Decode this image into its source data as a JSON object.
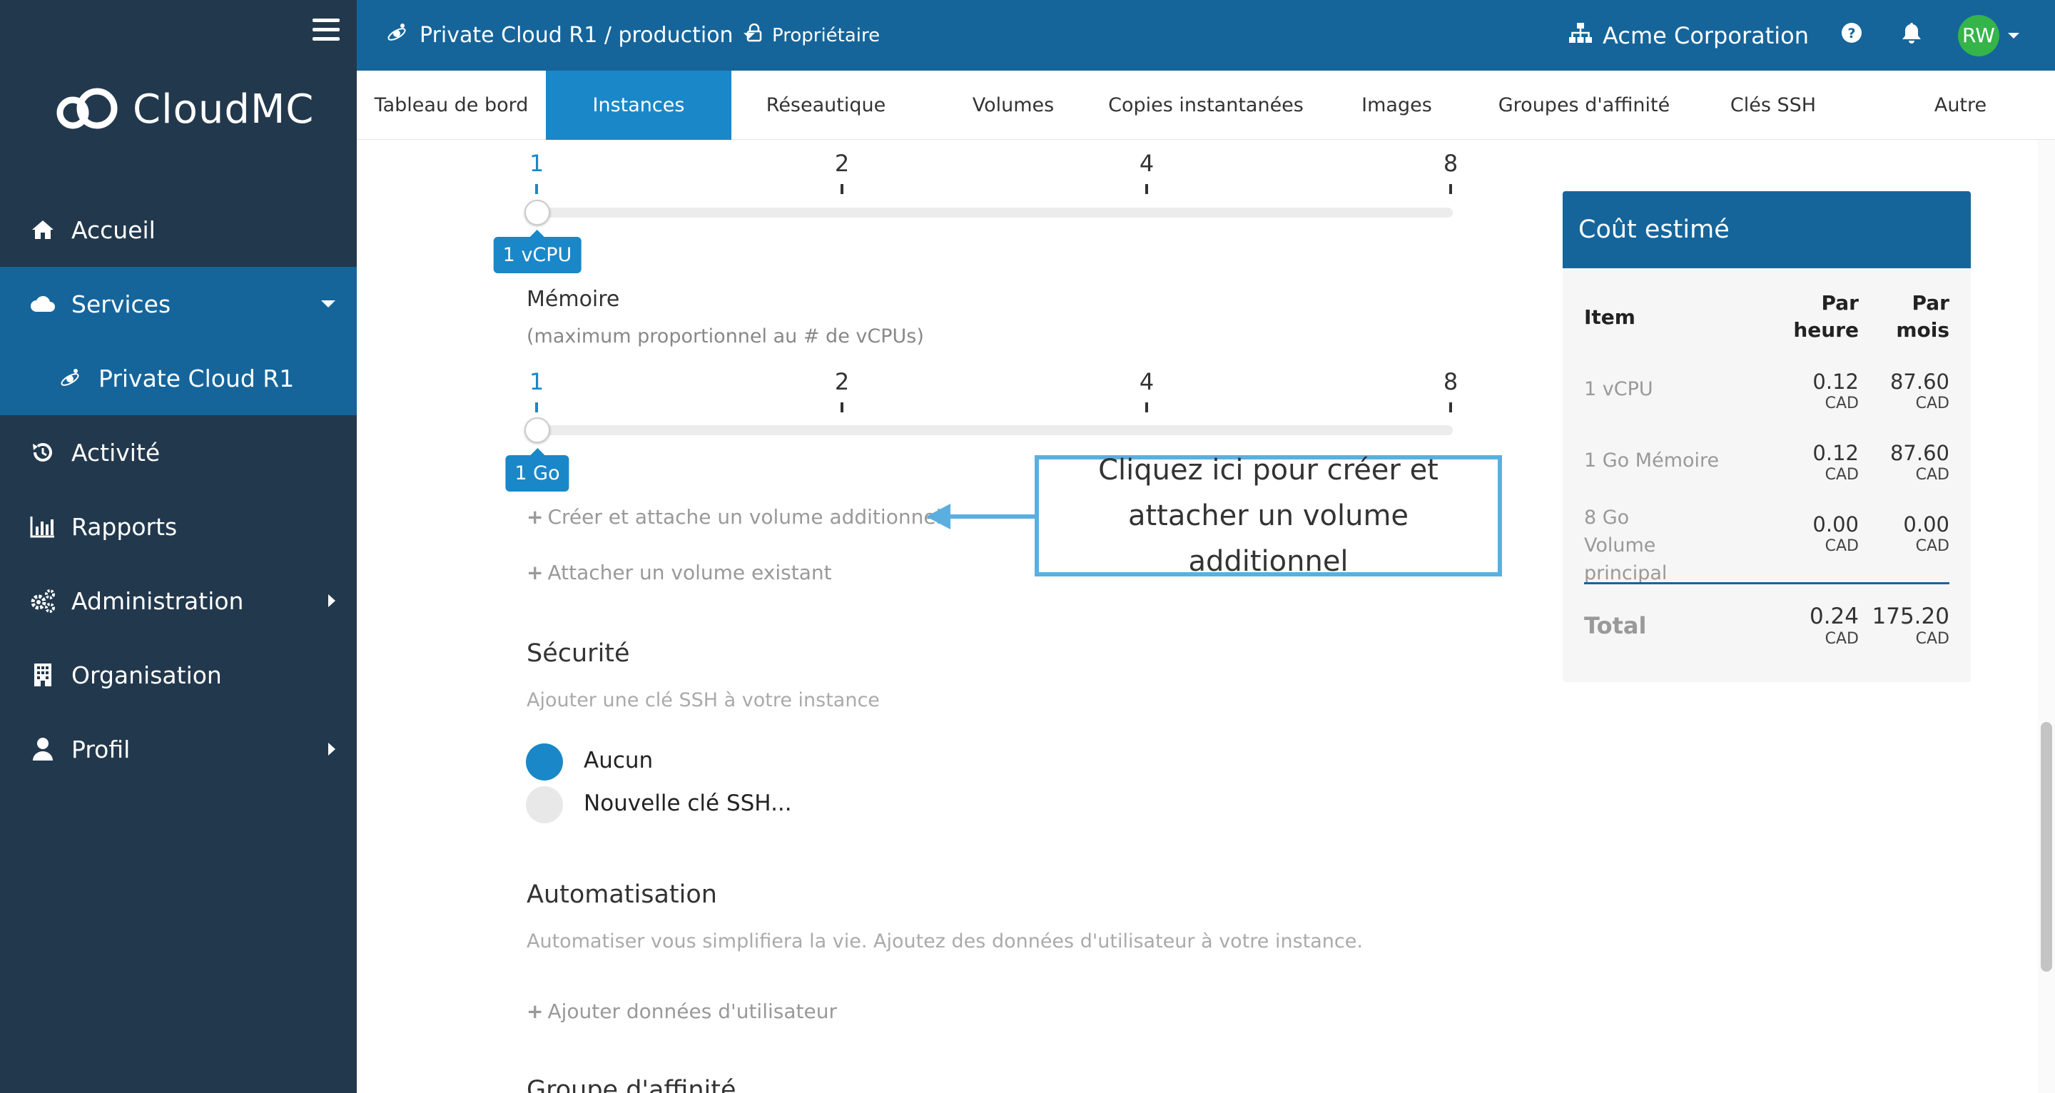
{
  "sidebar": {
    "logo_text": "CloudMC",
    "items": [
      {
        "label": "Accueil",
        "icon": "home-icon"
      },
      {
        "label": "Services",
        "icon": "cloud-icon"
      },
      {
        "label": "Private Cloud R1",
        "icon": "satellite-icon"
      },
      {
        "label": "Activité",
        "icon": "history-icon"
      },
      {
        "label": "Rapports",
        "icon": "bar-chart-icon"
      },
      {
        "label": "Administration",
        "icon": "gears-icon"
      },
      {
        "label": "Organisation",
        "icon": "building-icon"
      },
      {
        "label": "Profil",
        "icon": "user-icon"
      }
    ]
  },
  "topbar": {
    "environment": "Private Cloud R1 / production",
    "role": "Propriétaire",
    "organization": "Acme Corporation",
    "avatar_initials": "RW"
  },
  "tabs": [
    "Tableau de bord",
    "Instances",
    "Réseautique",
    "Volumes",
    "Copies instantanées",
    "Images",
    "Groupes d'affinité",
    "Clés SSH",
    "Autre"
  ],
  "active_tab": "Instances",
  "form": {
    "cpu_slider": {
      "ticks": [
        "1",
        "2",
        "4",
        "8"
      ],
      "selected": "1",
      "badge": "1 vCPU"
    },
    "memory": {
      "label": "Mémoire",
      "hint": "(maximum proportionnel au # de vCPUs)",
      "ticks": [
        "1",
        "2",
        "4",
        "8"
      ],
      "selected": "1",
      "badge": "1 Go"
    },
    "create_volume_link": "Créer et attache un volume additionnel",
    "attach_volume_link": "Attacher un volume existant",
    "callout": "Cliquez ici pour créer et attacher un volume additionnel",
    "security": {
      "title": "Sécurité",
      "hint": "Ajouter une clé SSH à votre instance",
      "options": [
        "Aucun",
        "Nouvelle clé SSH..."
      ],
      "selected": "Aucun"
    },
    "automation": {
      "title": "Automatisation",
      "hint": "Automatiser vous simplifiera la vie. Ajoutez des données d'utilisateur à votre instance.",
      "link": "Ajouter données d'utilisateur"
    },
    "affinity_title": "Groupe d'affinité"
  },
  "cost": {
    "title": "Coût estimé",
    "headers": {
      "item": "Item",
      "hour": "Par heure",
      "month": "Par mois"
    },
    "rows": [
      {
        "item": "1 vCPU",
        "hour": "0.12",
        "month": "87.60",
        "currency": "CAD"
      },
      {
        "item": "1 Go Mémoire",
        "hour": "0.12",
        "month": "87.60",
        "currency": "CAD"
      },
      {
        "item": "8 Go Volume principal",
        "hour": "0.00",
        "month": "0.00",
        "currency": "CAD"
      }
    ],
    "total": {
      "label": "Total",
      "hour": "0.24",
      "month": "175.20",
      "currency": "CAD"
    }
  },
  "colors": {
    "sidebar": "#22384d",
    "primary": "#15659b",
    "accent": "#1a87c8",
    "callout": "#5aafe0",
    "avatar": "#35b44a"
  }
}
